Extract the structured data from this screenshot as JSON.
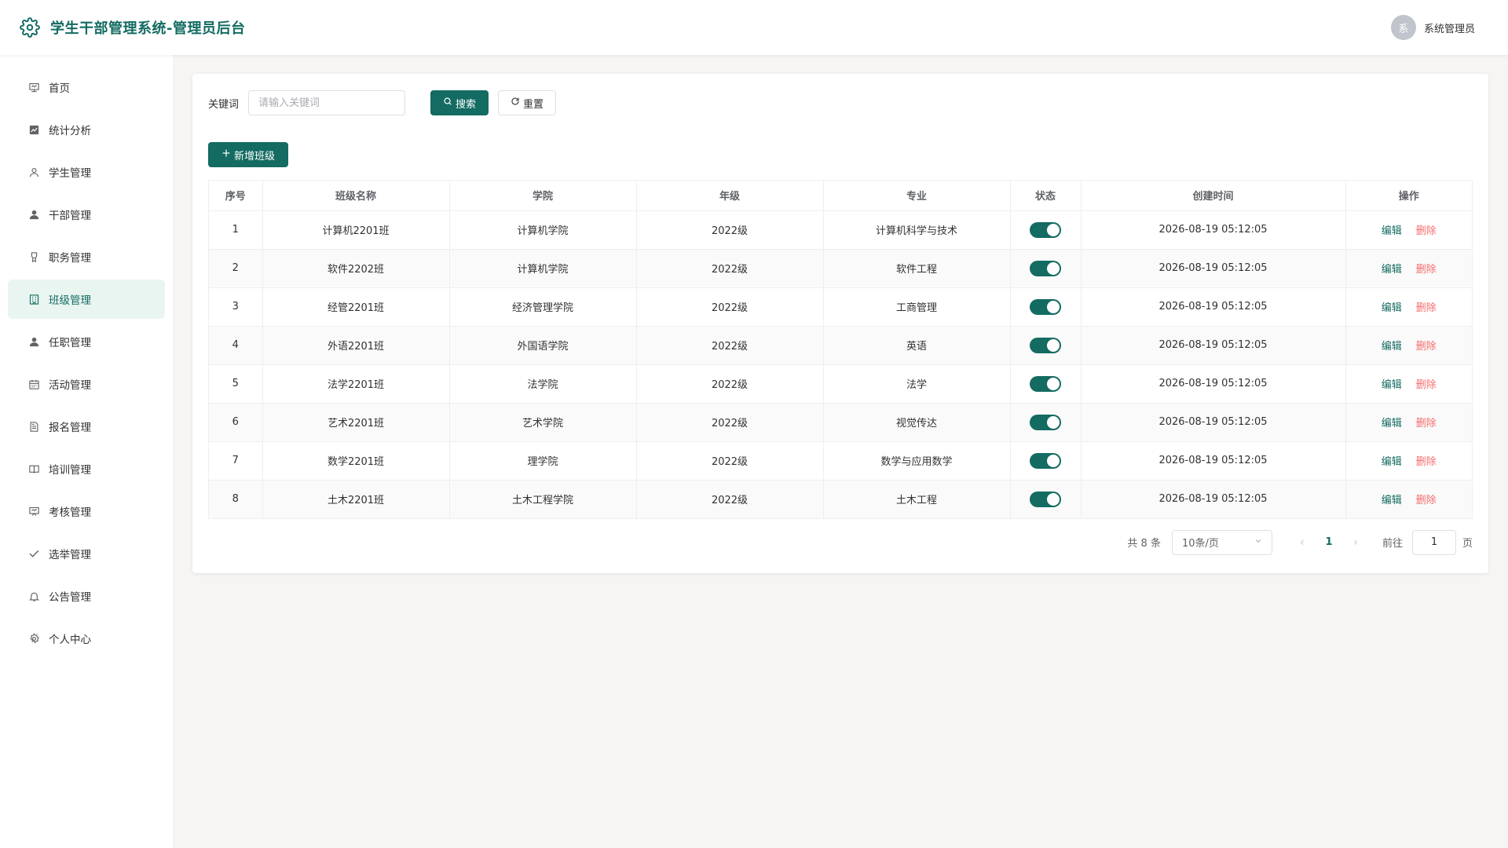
{
  "header": {
    "title": "学生干部管理系统-管理员后台",
    "avatar_text": "系",
    "username": "系统管理员"
  },
  "sidebar": {
    "items": [
      {
        "label": "首页",
        "icon": "home-icon"
      },
      {
        "label": "统计分析",
        "icon": "chart-icon"
      },
      {
        "label": "学生管理",
        "icon": "user-icon"
      },
      {
        "label": "干部管理",
        "icon": "user-filled-icon"
      },
      {
        "label": "职务管理",
        "icon": "badge-icon"
      },
      {
        "label": "班级管理",
        "icon": "building-icon",
        "active": true
      },
      {
        "label": "任职管理",
        "icon": "user-filled-icon"
      },
      {
        "label": "活动管理",
        "icon": "calendar-icon"
      },
      {
        "label": "报名管理",
        "icon": "document-icon"
      },
      {
        "label": "培训管理",
        "icon": "book-icon"
      },
      {
        "label": "考核管理",
        "icon": "board-icon"
      },
      {
        "label": "选举管理",
        "icon": "check-icon"
      },
      {
        "label": "公告管理",
        "icon": "bell-icon"
      },
      {
        "label": "个人中心",
        "icon": "gear-icon"
      }
    ]
  },
  "search": {
    "label": "关键词",
    "placeholder": "请输入关键词",
    "value": "",
    "search_label": "搜索",
    "reset_label": "重置"
  },
  "toolbar": {
    "add_label": "新增班级"
  },
  "table": {
    "columns": [
      "序号",
      "班级名称",
      "学院",
      "年级",
      "专业",
      "状态",
      "创建时间",
      "操作"
    ],
    "edit_label": "编辑",
    "delete_label": "删除",
    "rows": [
      {
        "idx": "1",
        "name": "计算机2201班",
        "college": "计算机学院",
        "grade": "2022级",
        "major": "计算机科学与技术",
        "enabled": true,
        "created": "2026-08-19 05:12:05"
      },
      {
        "idx": "2",
        "name": "软件2202班",
        "college": "计算机学院",
        "grade": "2022级",
        "major": "软件工程",
        "enabled": true,
        "created": "2026-08-19 05:12:05"
      },
      {
        "idx": "3",
        "name": "经管2201班",
        "college": "经济管理学院",
        "grade": "2022级",
        "major": "工商管理",
        "enabled": true,
        "created": "2026-08-19 05:12:05"
      },
      {
        "idx": "4",
        "name": "外语2201班",
        "college": "外国语学院",
        "grade": "2022级",
        "major": "英语",
        "enabled": true,
        "created": "2026-08-19 05:12:05"
      },
      {
        "idx": "5",
        "name": "法学2201班",
        "college": "法学院",
        "grade": "2022级",
        "major": "法学",
        "enabled": true,
        "created": "2026-08-19 05:12:05"
      },
      {
        "idx": "6",
        "name": "艺术2201班",
        "college": "艺术学院",
        "grade": "2022级",
        "major": "视觉传达",
        "enabled": true,
        "created": "2026-08-19 05:12:05"
      },
      {
        "idx": "7",
        "name": "数学2201班",
        "college": "理学院",
        "grade": "2022级",
        "major": "数学与应用数学",
        "enabled": true,
        "created": "2026-08-19 05:12:05"
      },
      {
        "idx": "8",
        "name": "土木2201班",
        "college": "土木工程学院",
        "grade": "2022级",
        "major": "土木工程",
        "enabled": true,
        "created": "2026-08-19 05:12:05"
      }
    ]
  },
  "pagination": {
    "total_text": "共 8 条",
    "page_size": "10条/页",
    "current_page": "1",
    "goto_label": "前往",
    "goto_value": "1",
    "page_suffix": "页"
  },
  "colors": {
    "primary": "#136b62",
    "danger": "#f56c6c",
    "active_bg": "#e9f5f1"
  }
}
